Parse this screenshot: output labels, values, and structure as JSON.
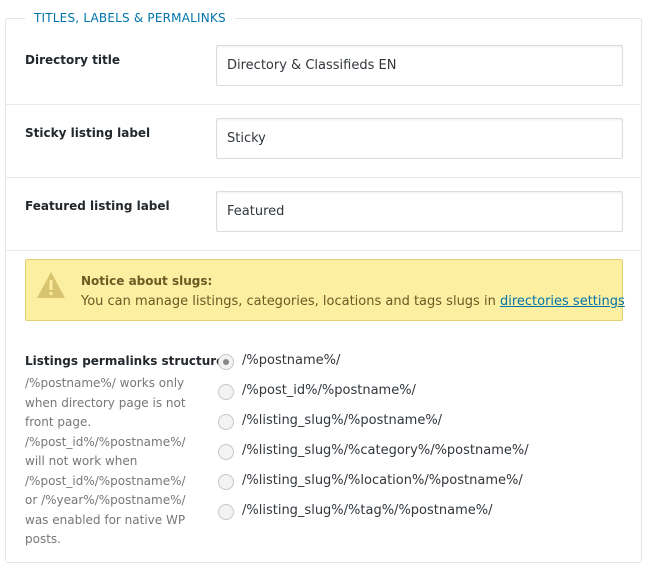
{
  "section": {
    "title": "TITLES, LABELS & PERMALINKS"
  },
  "fields": [
    {
      "label": "Directory title",
      "value": "Directory & Classifieds EN"
    },
    {
      "label": "Sticky listing label",
      "value": "Sticky"
    },
    {
      "label": "Featured listing label",
      "value": "Featured"
    }
  ],
  "notice": {
    "icon": "warning-icon",
    "title": "Notice about slugs:",
    "text": "You can manage listings, categories, locations and tags slugs in ",
    "link_text": "directories settings"
  },
  "permalinks": {
    "label": "Listings permalinks structure",
    "description": "/%postname%/ works only\nwhen directory page is not\nfront page.\n/%post_id%/%postname%/\nwill not work when\n/%post_id%/%postname%/\nor /%year%/%postname%/\nwas enabled for native WP\nposts.",
    "selected_index": 0,
    "options": [
      "/%postname%/",
      "/%post_id%/%postname%/",
      "/%listing_slug%/%postname%/",
      "/%listing_slug%/%category%/%postname%/",
      "/%listing_slug%/%location%/%postname%/",
      "/%listing_slug%/%tag%/%postname%/"
    ]
  },
  "colors": {
    "accent": "#0073aa",
    "notice_bg": "#fcefa1",
    "notice_border": "#e6d179"
  }
}
